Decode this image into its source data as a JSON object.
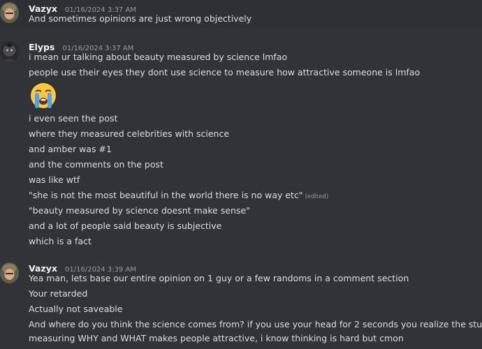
{
  "messages": [
    {
      "author": "Vazyx",
      "timestamp": "01/16/2024 3:37 AM",
      "avatar_icon": "helmeted-soldier-avatar",
      "lines": [
        "And sometimes opinions are just wrong objectively"
      ]
    },
    {
      "author": "Elyps",
      "timestamp": "01/16/2024 3:37 AM",
      "avatar_icon": "dark-character-avatar",
      "lines": [
        "i mean ur talking about beauty measured by science lmfao",
        "people use their eyes they dont use science to measure how attractive someone is lmfao"
      ],
      "emoji": "loudly-crying-face-emoji",
      "lines_after_emoji": [
        "i even seen the post",
        "where they measured celebrities with science",
        "and amber was #1",
        "and the comments on the post",
        "was like wtf",
        "\"she is not the most beautiful in the world there is no way etc\"",
        "\"beauty measured by science doesnt make sense\"",
        "and a lot of people said beauty is subjective",
        "which is a fact"
      ],
      "edited_label": "(edited)"
    },
    {
      "author": "Vazyx",
      "timestamp": "01/16/2024 3:39 AM",
      "avatar_icon": "helmeted-soldier-avatar",
      "lines": [
        "Yea man, lets base our entire opinion on 1 guy or a few randoms in a comment section",
        "Your retarded",
        "Actually not saveable",
        "And where do you think the science comes from? if you use your head for 2 seconds you realize the study is",
        "measuring WHY and WHAT makes people attractive, i know thinking is hard but cmon"
      ]
    }
  ]
}
